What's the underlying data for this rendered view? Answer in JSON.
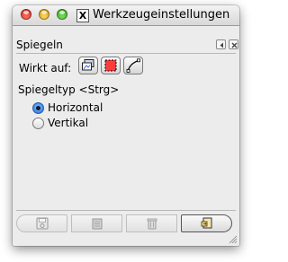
{
  "window": {
    "title": "Werkzeugeinstellungen"
  },
  "dock": {
    "title": "Spiegeln"
  },
  "options": {
    "wirkt_auf_label": "Wirkt auf:",
    "spiegeltyp_label": "Spiegeltyp  <Strg>",
    "radio_horizontal": "Horizontal",
    "radio_vertical": "Vertikal",
    "selected": "Horizontal"
  },
  "icons": {
    "close": "close-traffic-light",
    "minimize": "minimize-traffic-light",
    "zoom": "zoom-traffic-light",
    "x11": "x11-icon",
    "dock_menu": "left-arrow-icon",
    "dock_close": "close-icon",
    "layer": "layer-icon",
    "selection": "selection-icon",
    "path": "path-icon",
    "save": "save-icon",
    "restore": "restore-icon",
    "delete": "trash-icon",
    "reset": "reset-icon"
  }
}
